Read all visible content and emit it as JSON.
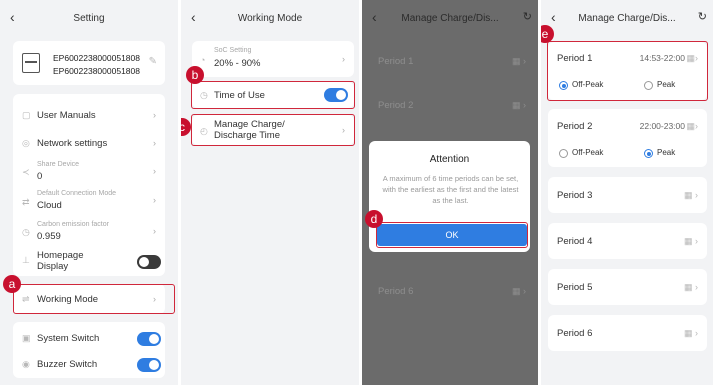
{
  "screen1": {
    "title": "Setting",
    "device_line1": "EP6002238000051808",
    "device_line2": "EP6002238000051808",
    "user_manuals": "User Manuals",
    "network_settings": "Network settings",
    "share_device_label": "Share Device",
    "share_device_value": "0",
    "default_mode_label": "Default Connection Mode",
    "default_mode_value": "Cloud",
    "carbon_label": "Carbon emission factor",
    "carbon_value": "0.959",
    "homepage_display": "Homepage Display",
    "working_mode": "Working Mode",
    "system_switch": "System Switch",
    "buzzer_switch": "Buzzer Switch",
    "callout": "a"
  },
  "screen2": {
    "title": "Working Mode",
    "soc_label": "SoC Setting",
    "soc_value": "20% - 90%",
    "time_of_use": "Time of Use",
    "manage_charge": "Manage Charge/",
    "discharge_time": "Discharge Time",
    "callout_b": "b",
    "callout_c": "c"
  },
  "screen3": {
    "title": "Manage Charge/Dis...",
    "periods": [
      "Period 1",
      "Period 2",
      "Period 6"
    ],
    "dialog_title": "Attention",
    "dialog_message": "A maximum of 6 time periods can be set, with the earliest as the first and the latest as the last.",
    "ok_label": "OK",
    "callout": "d"
  },
  "screen4": {
    "title": "Manage Charge/Dis...",
    "period1_label": "Period 1",
    "period1_time": "14:53-22:00",
    "period2_label": "Period 2",
    "period2_time": "22:00-23:00",
    "off_peak": "Off-Peak",
    "peak": "Peak",
    "period3": "Period 3",
    "period4": "Period 4",
    "period5": "Period 5",
    "period6": "Period 6",
    "callout": "e"
  },
  "colors": {
    "accent": "#2f7de1",
    "callout": "#c8102e",
    "highlight_border": "#d0273b"
  }
}
